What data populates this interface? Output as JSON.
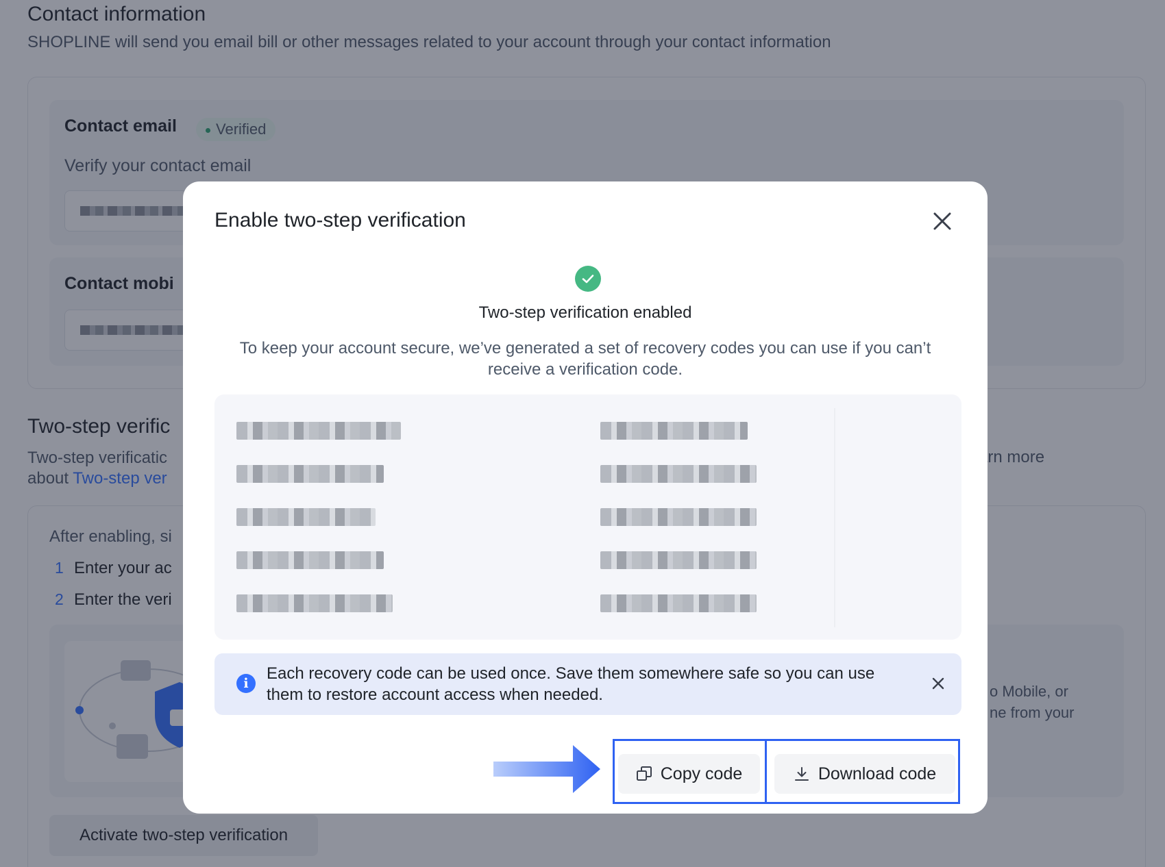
{
  "background": {
    "contact_info": {
      "title": "Contact information",
      "subtitle": "SHOPLINE will send you email bill or other messages related to your account through your contact information",
      "email": {
        "label": "Contact email",
        "badge": "Verified",
        "hint": "Verify your contact email"
      },
      "mobile": {
        "label": "Contact mobi"
      }
    },
    "two_step": {
      "title": "Two-step verific",
      "desc_line1": "Two-step verificatic",
      "desc_line2_prefix": "about ",
      "desc_link": "Two-step ver",
      "right_text": "arn more",
      "after_enabling": "After enabling, si",
      "steps": [
        {
          "num": "1",
          "text": "Enter your ac"
        },
        {
          "num": "2",
          "text": "Enter the veri"
        }
      ],
      "note_line1": "o Mobile, or",
      "note_line2": "ne from your",
      "activate_button": "Activate two-step verification"
    }
  },
  "modal": {
    "title": "Enable two-step verification",
    "success_title": "Two-step verification enabled",
    "success_desc": "To keep your account secure, we’ve generated a set of recovery codes you can use if you can’t receive a verification code.",
    "alert_text": "Each recovery code can be used once. Save them somewhere safe so you can use them to restore account access when needed.",
    "buttons": {
      "copy": "Copy code",
      "download": "Download code"
    },
    "colors": {
      "success": "#45b883",
      "info": "#3370ff",
      "highlight": "#2f62f2",
      "alert_bg": "#e6ebfa"
    }
  }
}
